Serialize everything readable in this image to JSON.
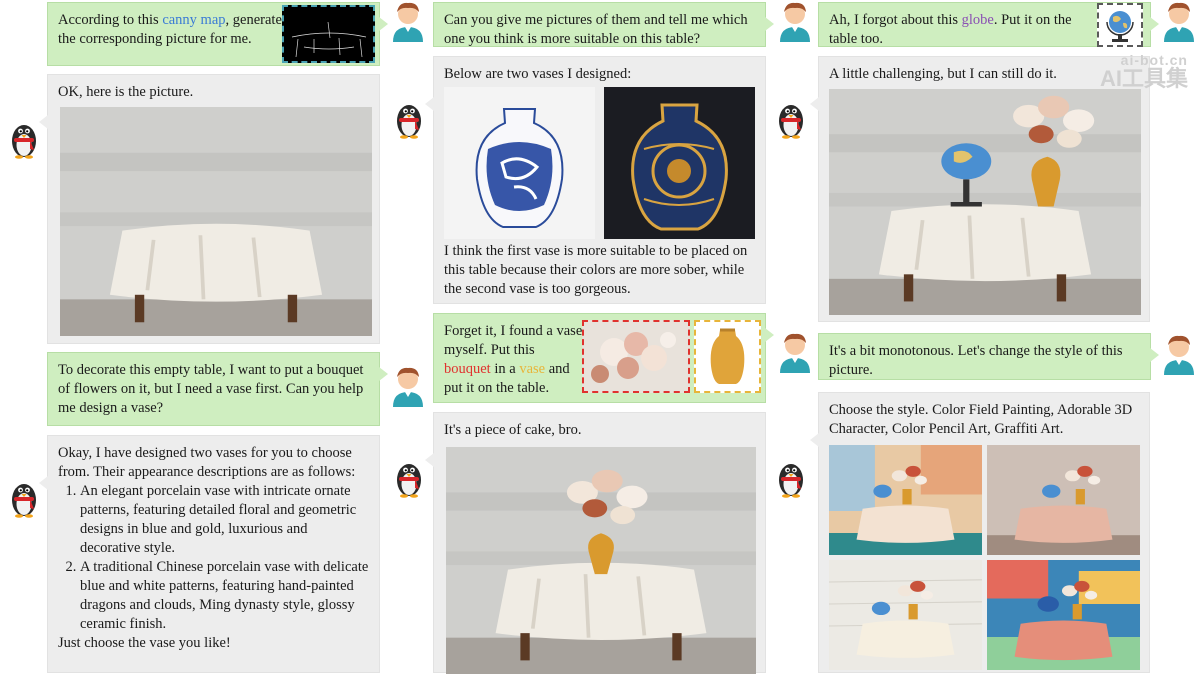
{
  "col1": {
    "m1": {
      "pre": "According to this ",
      "hl": "canny map",
      "post": ", generate the corresponding picture for me."
    },
    "m2": {
      "text": "OK, here is the picture."
    },
    "m3": {
      "text": "To decorate this empty table, I want to put a bouquet of flowers on it, but I need a vase first. Can you help me design a vase?"
    },
    "m4": {
      "intro": "Okay, I have designed two vases for you to choose from. Their appearance descriptions are as follows:",
      "items": [
        "An elegant porcelain vase with intricate ornate patterns, featuring detailed floral and geometric designs in blue and gold, luxurious and decorative style.",
        "A traditional Chinese porcelain vase with delicate blue and white patterns, featuring hand-painted dragons and clouds, Ming dynasty style, glossy ceramic finish."
      ],
      "outro": "Just choose the vase you like!"
    }
  },
  "col2": {
    "m1": {
      "text": "Can you give me pictures of them and tell me which one you think is more suitable on this table?"
    },
    "m2": {
      "head": "Below are two vases I designed:",
      "body": "I think the first vase is more suitable to be placed on this table because their colors are more sober, while the second vase is too gorgeous."
    },
    "m3": {
      "a": "Forget it, I found a vase myself. Put this ",
      "b": "bouquet",
      "c": " in a ",
      "d": "vase",
      "e": " and put it on the table."
    },
    "m4": {
      "text": "It's a piece of cake, bro."
    }
  },
  "col3": {
    "m1": {
      "pre": "Ah, I forgot about this ",
      "hl": "globe",
      "post": ". Put it on the table too."
    },
    "m2": {
      "text": "A little challenging, but I can still do it."
    },
    "m3": {
      "text": "It's a bit monotonous. Let's change the style of this picture."
    },
    "m4": {
      "text": "Choose the style. Color Field Painting, Adorable 3D Character, Color Pencil Art, Graffiti Art."
    }
  },
  "watermark": {
    "line1": "ai-bot.cn",
    "line2": "AI工具集"
  },
  "colors": {
    "user_bubble": "#cfeec0",
    "bot_bubble": "#ededed",
    "hl_blue": "#3a7bd5",
    "hl_purple": "#8a4fb3",
    "hl_red": "#e0322e",
    "hl_yellow": "#e8b53a"
  },
  "icons": {
    "user": "user-avatar-icon",
    "bot": "penguin-avatar-icon"
  }
}
